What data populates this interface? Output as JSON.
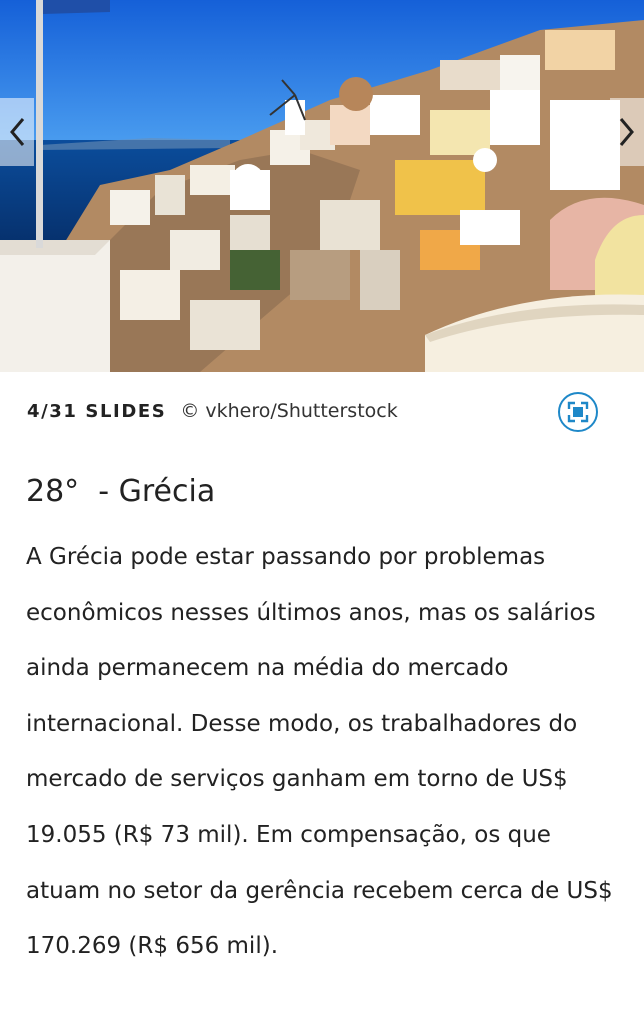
{
  "slide": {
    "counter": "4/31 SLIDES",
    "credit_symbol": "©",
    "credit": "vkhero/Shutterstock",
    "prev_icon": "chevron-left-icon",
    "next_icon": "chevron-right-icon",
    "fullscreen_icon": "fullscreen-icon",
    "image": "santorini-oia-photo"
  },
  "article": {
    "title": "28°  - Grécia",
    "body": "A Grécia pode estar passando por problemas econômicos nesses últimos anos, mas os salários ainda permanecem na média do mercado internacional. Desse modo, os trabalhadores do mercado de serviços ganham em torno de US$ 19.055 (R$ 73 mil). Em compensação, os que atuam no setor da gerência recebem cerca de US$ 170.269 (R$ 656 mil)."
  },
  "colors": {
    "accent": "#1e88c8",
    "sky": "#1f6fd6",
    "sea": "#0a3f8a"
  }
}
